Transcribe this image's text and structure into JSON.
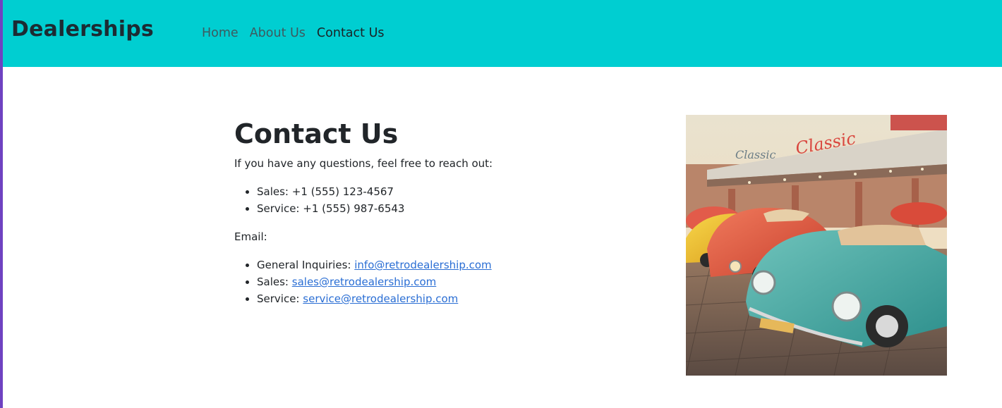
{
  "navbar": {
    "brand": "Dealerships",
    "links": [
      {
        "label": "Home",
        "active": false
      },
      {
        "label": "About Us",
        "active": false
      },
      {
        "label": "Contact Us",
        "active": true
      }
    ]
  },
  "contact": {
    "title": "Contact Us",
    "intro": "If you have any questions, feel free to reach out:",
    "phones": [
      {
        "label": "Sales:",
        "value": "+1 (555) 123-4567"
      },
      {
        "label": "Service:",
        "value": "+1 (555) 987-6543"
      }
    ],
    "email_heading": "Email:",
    "emails": [
      {
        "label": "General Inquiries:",
        "value": "info@retrodealership.com"
      },
      {
        "label": "Sales:",
        "value": "sales@retrodealership.com"
      },
      {
        "label": "Service:",
        "value": "service@retrodealership.com"
      }
    ]
  },
  "colors": {
    "navbar_bg": "#00ced1",
    "left_accent": "#6f42c1",
    "link": "#2a6ed4"
  },
  "image": {
    "subject": "vintage-convertibles-at-dealership-illustration",
    "sign_text": "Classic"
  }
}
